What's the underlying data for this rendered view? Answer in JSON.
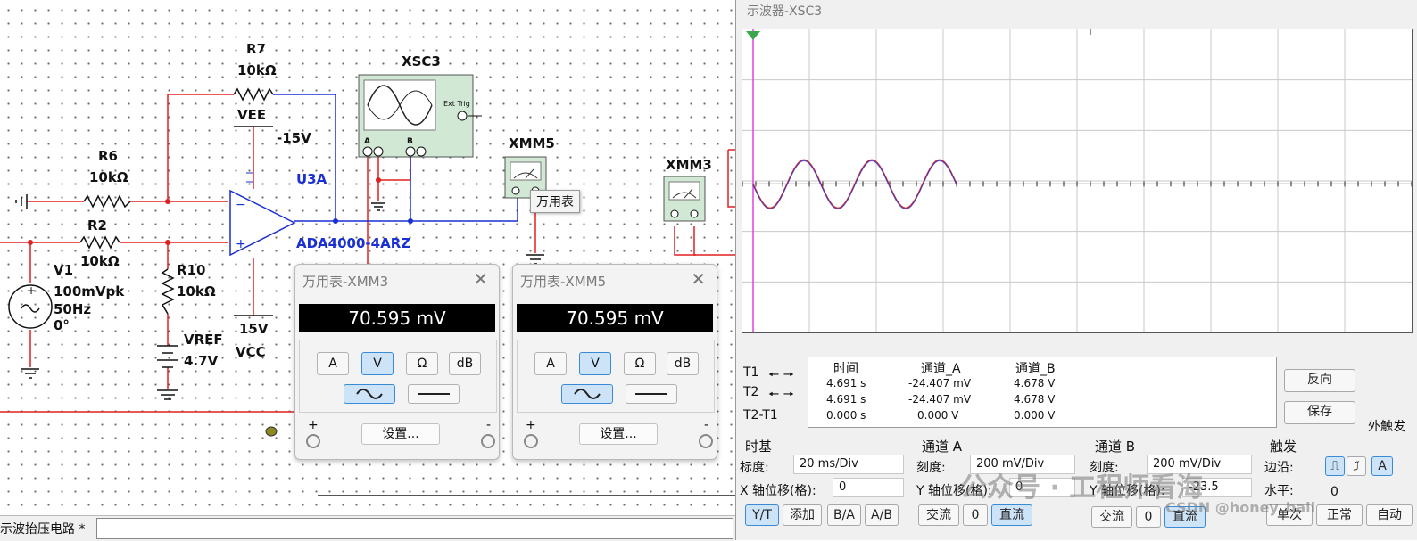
{
  "schematic": {
    "labels": {
      "r7": "R7",
      "r7_val": "10kΩ",
      "vee": "VEE",
      "minus15": "-15V",
      "xsc3": "XSC3",
      "ext_trig": "Ext Trig",
      "ch_a": "A",
      "ch_b": "B",
      "r6": "R6",
      "r6_val": "10kΩ",
      "u3a": "U3A",
      "r2": "R2",
      "r2_val": "10kΩ",
      "opamp": "ADA4000-4ARZ",
      "v1": "V1",
      "v1_amp": "100mVpk",
      "v1_freq": "50Hz",
      "v1_phase": "0°",
      "r10": "R10",
      "r10_val": "10kΩ",
      "vref": "VREF",
      "vref_val": "4.7V",
      "vcc_val": "15V",
      "vcc": "VCC",
      "xmm5": "XMM5",
      "xmm3": "XMM3"
    },
    "tooltip": "万用表",
    "status_bar_text": "示波抬压电路 *"
  },
  "meters": [
    {
      "title": "万用表-XMM3",
      "reading": "70.595 mV",
      "buttons": [
        "A",
        "V",
        "Ω",
        "dB"
      ],
      "selected": "V",
      "settings": "设置...",
      "plus": "+",
      "minus": "-"
    },
    {
      "title": "万用表-XMM5",
      "reading": "70.595 mV",
      "buttons": [
        "A",
        "V",
        "Ω",
        "dB"
      ],
      "selected": "V",
      "settings": "设置...",
      "plus": "+",
      "minus": "-"
    }
  ],
  "scope": {
    "title": "示波器-XSC3",
    "trace_colors": {
      "a": "#d03030",
      "b": "#3030d0",
      "trigger": "#e040e0"
    },
    "cursors": {
      "headers": [
        "时间",
        "通道_A",
        "通道_B"
      ],
      "rows": [
        {
          "label": "T1",
          "time": "4.691 s",
          "a": "-24.407 mV",
          "b": "4.678 V"
        },
        {
          "label": "T2",
          "time": "4.691 s",
          "a": "-24.407 mV",
          "b": "4.678 V"
        },
        {
          "label": "T2-T1",
          "time": "0.000 s",
          "a": "0.000 V",
          "b": "0.000 V"
        }
      ]
    },
    "reverse_button": "反向",
    "save_button": "保存",
    "ext_trigger": "外触发",
    "timebase": {
      "label": "时基",
      "scale_label": "标度:",
      "scale": "20 ms/Div",
      "xpos_label": "X 轴位移(格):",
      "xpos": "0",
      "modes": [
        "Y/T",
        "添加",
        "B/A",
        "A/B"
      ]
    },
    "channel_a": {
      "label": "通道 A",
      "scale_label": "刻度:",
      "scale": "200 mV/Div",
      "ypos_label": "Y 轴位移(格):",
      "ypos": "0",
      "coupling": [
        "交流",
        "0",
        "直流"
      ]
    },
    "channel_b": {
      "label": "通道 B",
      "scale_label": "刻度:",
      "scale": "200 mV/Div",
      "ypos_label": "Y 轴位移(格):",
      "ypos": "-23.5",
      "coupling": [
        "交流",
        "0",
        "直流"
      ]
    },
    "trigger": {
      "label": "触发",
      "edge_label": "边沿:",
      "edge_a": "A",
      "level_label": "水平:",
      "level": "0",
      "modes": [
        "单次",
        "正常",
        "自动"
      ]
    }
  },
  "watermarks": {
    "wechat": "公众号 · 工程师看海",
    "csdn": "CSDN @honey_ball"
  }
}
